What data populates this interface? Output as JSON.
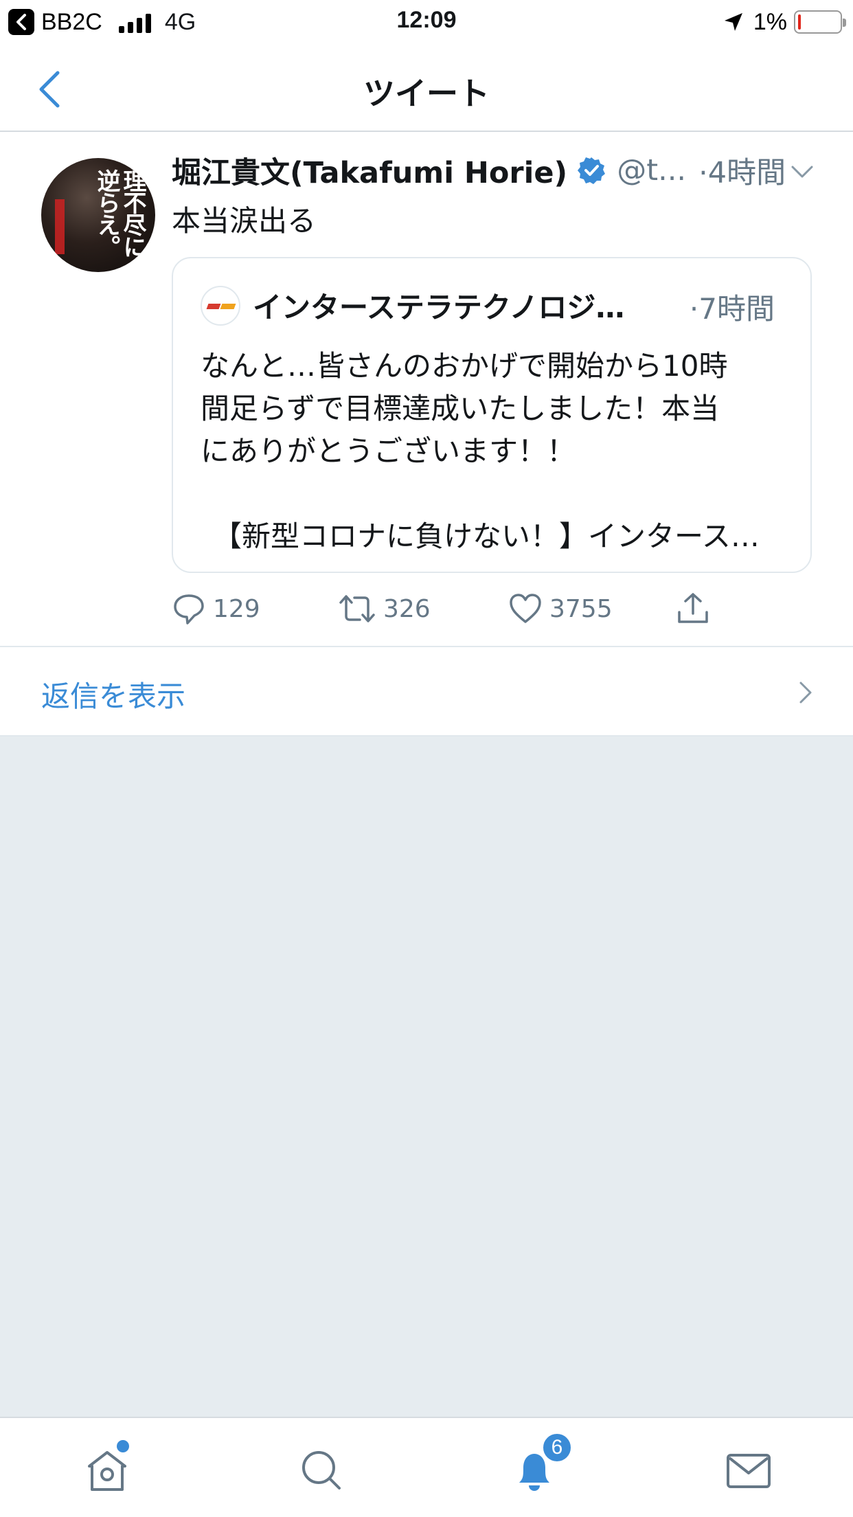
{
  "status_bar": {
    "carrier": "BB2C",
    "network": "4G",
    "time": "12:09",
    "battery": "1%",
    "battery_level": 0.01
  },
  "nav": {
    "title": "ツイート"
  },
  "tweet": {
    "display_name": "堀江貴文(Takafumi Horie)",
    "handle": "@t...",
    "time": "·4時間",
    "text": "本当涙出る",
    "avatar_text": "理不尽に逆らえ。",
    "quote": {
      "name": "インターステラテクノロジ…",
      "time": "·7時間",
      "body": "なんと…皆さんのおかげで開始から10時\n間足らずで目標達成いたしました！本当\nにありがとうございます！！",
      "body2": "【新型コロナに負けない！】インタース…"
    },
    "actions": {
      "replies": "129",
      "retweets": "326",
      "likes": "3755"
    }
  },
  "replies_link": {
    "label": "返信を表示"
  },
  "tabbar": {
    "notifications_badge": "6"
  },
  "colors": {
    "accent": "#3a8bd6",
    "muted": "#657786",
    "divider": "#e1e8ed",
    "background_gray": "#e6ecf0"
  }
}
